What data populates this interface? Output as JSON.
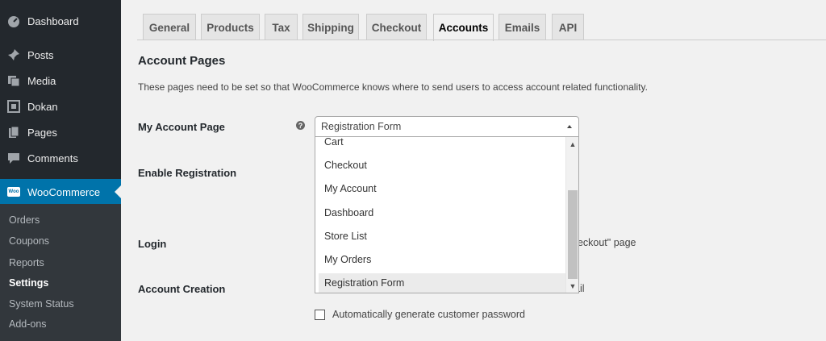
{
  "sidebar": {
    "items": [
      {
        "label": "Dashboard",
        "icon": "dashboard-icon"
      },
      {
        "label": "Posts",
        "icon": "pin-icon"
      },
      {
        "label": "Media",
        "icon": "media-icon"
      },
      {
        "label": "Dokan",
        "icon": "dokan-icon"
      },
      {
        "label": "Pages",
        "icon": "pages-icon"
      },
      {
        "label": "Comments",
        "icon": "comments-icon"
      },
      {
        "label": "WooCommerce",
        "icon": "woocommerce-icon",
        "logo_text": "Woo"
      }
    ],
    "submenu": [
      "Orders",
      "Coupons",
      "Reports",
      "Settings",
      "System Status",
      "Add-ons"
    ]
  },
  "tabs": [
    "General",
    "Products",
    "Tax",
    "Shipping",
    "Checkout",
    "Accounts",
    "Emails",
    "API"
  ],
  "section": {
    "title": "Account Pages",
    "description": "These pages need to be set so that WooCommerce knows where to send users to access account related functionality."
  },
  "rows": {
    "my_account": "My Account Page",
    "enable_registration": "Enable Registration",
    "login": "Login",
    "account_creation": "Account Creation"
  },
  "help_glyph": "?",
  "select": {
    "value": "Registration Form",
    "options": [
      "Cart",
      "Checkout",
      "My Account",
      "Dashboard",
      "Store List",
      "My Orders",
      "Registration Form"
    ]
  },
  "partials": {
    "login_tail": "heckout\" page",
    "creation_tail": "ail"
  },
  "checkbox": {
    "label": "Automatically generate customer password"
  },
  "colors": {
    "sidebar_bg": "#23282d",
    "active_menu": "#0073aa",
    "page_bg": "#f1f1f1"
  }
}
